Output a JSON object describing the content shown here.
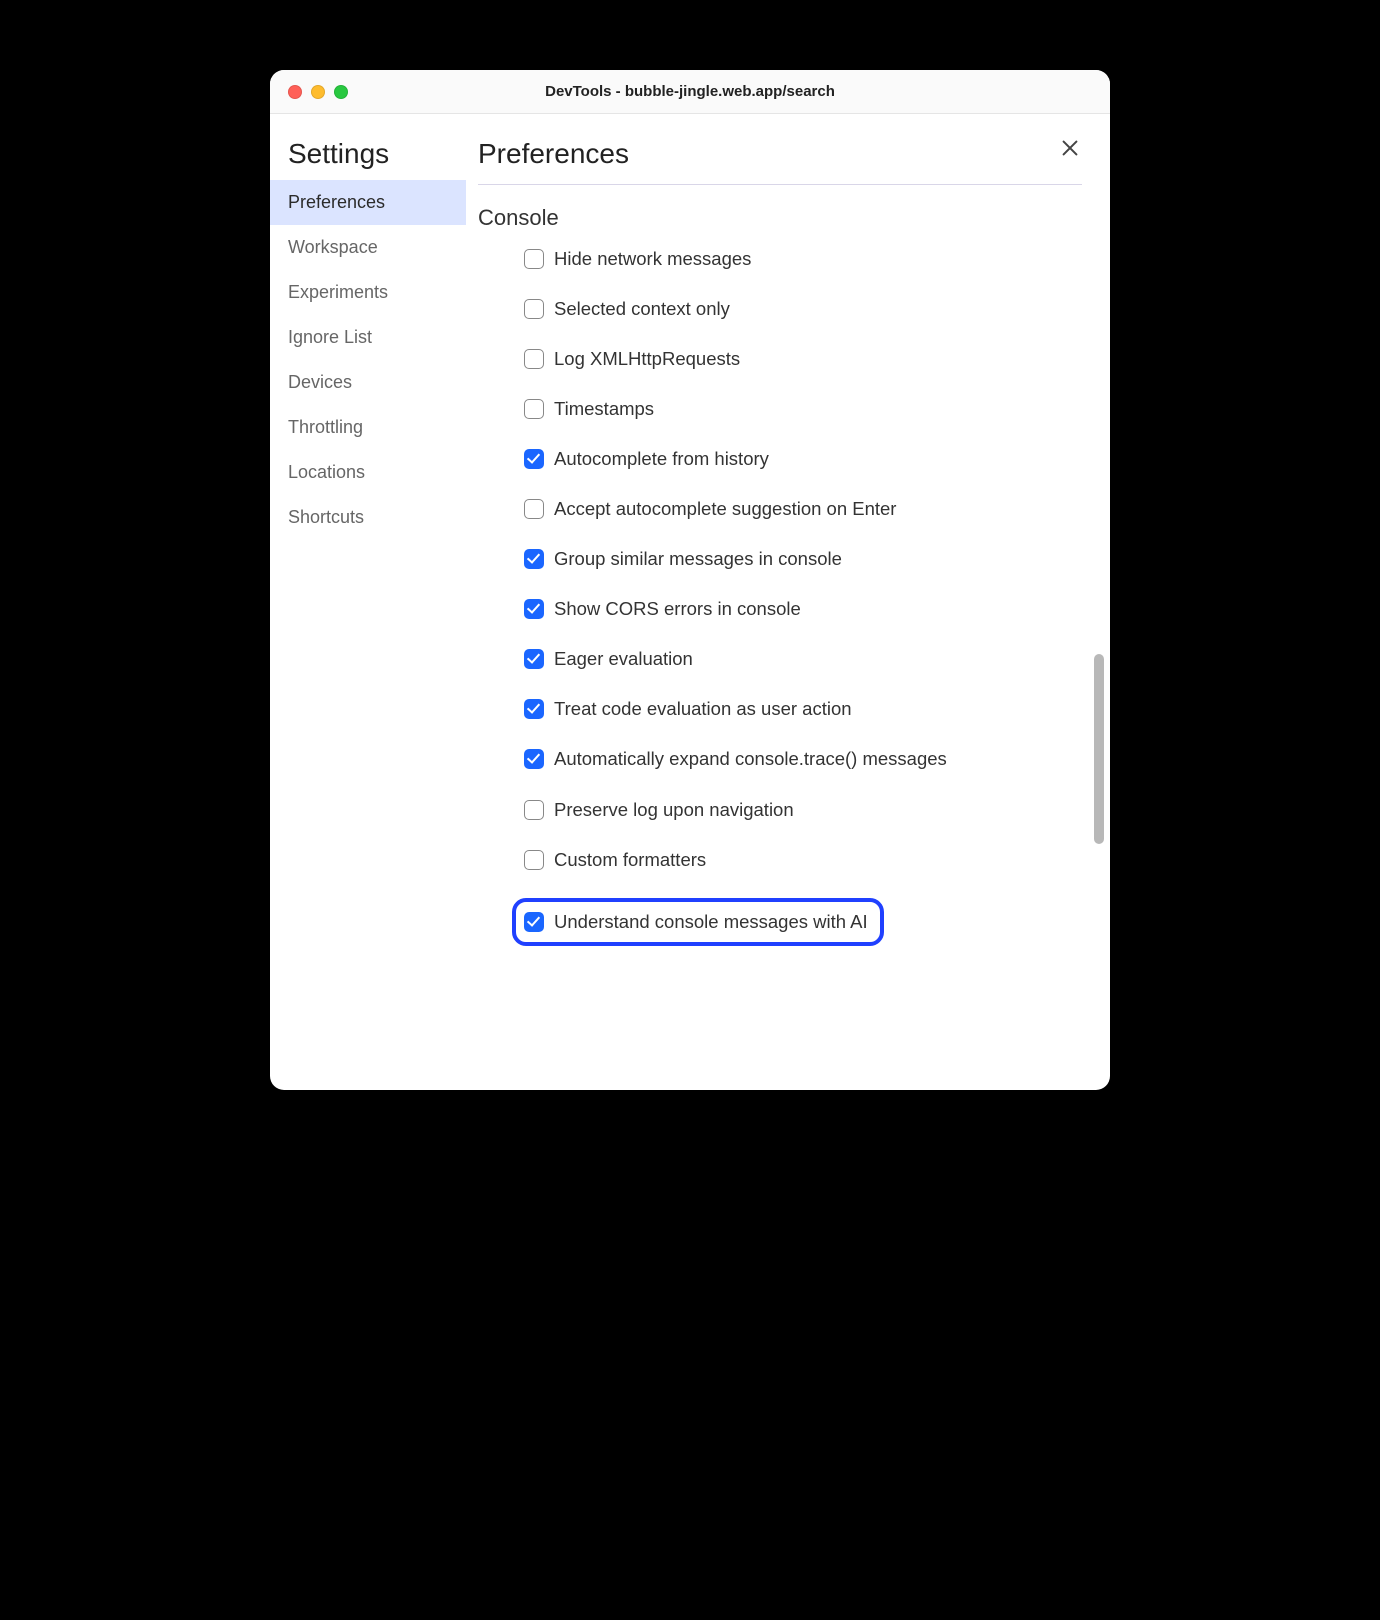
{
  "window": {
    "title": "DevTools - bubble-jingle.web.app/search"
  },
  "sidebar": {
    "title": "Settings",
    "items": [
      {
        "label": "Preferences",
        "active": true
      },
      {
        "label": "Workspace",
        "active": false
      },
      {
        "label": "Experiments",
        "active": false
      },
      {
        "label": "Ignore List",
        "active": false
      },
      {
        "label": "Devices",
        "active": false
      },
      {
        "label": "Throttling",
        "active": false
      },
      {
        "label": "Locations",
        "active": false
      },
      {
        "label": "Shortcuts",
        "active": false
      }
    ]
  },
  "main": {
    "title": "Preferences",
    "section": "Console",
    "options": [
      {
        "label": "Hide network messages",
        "checked": false,
        "highlight": false
      },
      {
        "label": "Selected context only",
        "checked": false,
        "highlight": false
      },
      {
        "label": "Log XMLHttpRequests",
        "checked": false,
        "highlight": false
      },
      {
        "label": "Timestamps",
        "checked": false,
        "highlight": false
      },
      {
        "label": "Autocomplete from history",
        "checked": true,
        "highlight": false
      },
      {
        "label": "Accept autocomplete suggestion on Enter",
        "checked": false,
        "highlight": false
      },
      {
        "label": "Group similar messages in console",
        "checked": true,
        "highlight": false
      },
      {
        "label": "Show CORS errors in console",
        "checked": true,
        "highlight": false
      },
      {
        "label": "Eager evaluation",
        "checked": true,
        "highlight": false
      },
      {
        "label": "Treat code evaluation as user action",
        "checked": true,
        "highlight": false
      },
      {
        "label": "Automatically expand console.trace() messages",
        "checked": true,
        "highlight": false
      },
      {
        "label": "Preserve log upon navigation",
        "checked": false,
        "highlight": false
      },
      {
        "label": "Custom formatters",
        "checked": false,
        "highlight": false
      },
      {
        "label": "Understand console messages with AI",
        "checked": true,
        "highlight": true
      }
    ]
  }
}
